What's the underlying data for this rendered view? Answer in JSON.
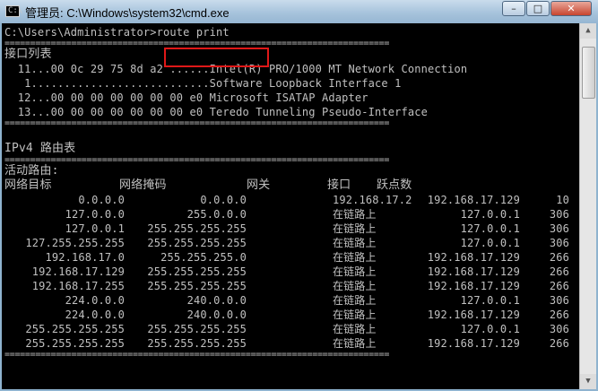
{
  "window": {
    "title": "管理员: C:\\Windows\\system32\\cmd.exe",
    "icon_text": "C:\\",
    "minimize": "–",
    "maximize": "□",
    "close": "✕"
  },
  "console": {
    "prompt": "C:\\Users\\Administrator>",
    "command": "route print",
    "separator": "===========================================================================",
    "interface_header": "接口列表",
    "interfaces": [
      "  11...00 0c 29 75 8d a2 ......Intel(R) PRO/1000 MT Network Connection",
      "   1...........................Software Loopback Interface 1",
      "  12...00 00 00 00 00 00 00 e0 Microsoft ISATAP Adapter",
      "  13...00 00 00 00 00 00 00 e0 Teredo Tunneling Pseudo-Interface"
    ],
    "ipv4_header": "IPv4 路由表",
    "active_routes_label": "活动路由:",
    "columns": {
      "dest": "网络目标",
      "mask": "网络掩码",
      "gateway": "网关",
      "iface": "接口",
      "metric": "跃点数"
    },
    "routes": [
      {
        "dest": "0.0.0.0",
        "mask": "0.0.0.0",
        "gateway": "192.168.17.2",
        "iface": "192.168.17.129",
        "metric": "10"
      },
      {
        "dest": "127.0.0.0",
        "mask": "255.0.0.0",
        "gateway": "在链路上",
        "iface": "127.0.0.1",
        "metric": "306"
      },
      {
        "dest": "127.0.0.1",
        "mask": "255.255.255.255",
        "gateway": "在链路上",
        "iface": "127.0.0.1",
        "metric": "306"
      },
      {
        "dest": "127.255.255.255",
        "mask": "255.255.255.255",
        "gateway": "在链路上",
        "iface": "127.0.0.1",
        "metric": "306"
      },
      {
        "dest": "192.168.17.0",
        "mask": "255.255.255.0",
        "gateway": "在链路上",
        "iface": "192.168.17.129",
        "metric": "266"
      },
      {
        "dest": "192.168.17.129",
        "mask": "255.255.255.255",
        "gateway": "在链路上",
        "iface": "192.168.17.129",
        "metric": "266"
      },
      {
        "dest": "192.168.17.255",
        "mask": "255.255.255.255",
        "gateway": "在链路上",
        "iface": "192.168.17.129",
        "metric": "266"
      },
      {
        "dest": "224.0.0.0",
        "mask": "240.0.0.0",
        "gateway": "在链路上",
        "iface": "127.0.0.1",
        "metric": "306"
      },
      {
        "dest": "224.0.0.0",
        "mask": "240.0.0.0",
        "gateway": "在链路上",
        "iface": "192.168.17.129",
        "metric": "266"
      },
      {
        "dest": "255.255.255.255",
        "mask": "255.255.255.255",
        "gateway": "在链路上",
        "iface": "127.0.0.1",
        "metric": "306"
      },
      {
        "dest": "255.255.255.255",
        "mask": "255.255.255.255",
        "gateway": "在链路上",
        "iface": "192.168.17.129",
        "metric": "266"
      }
    ]
  },
  "scrollbar": {
    "up": "▲",
    "down": "▼"
  }
}
